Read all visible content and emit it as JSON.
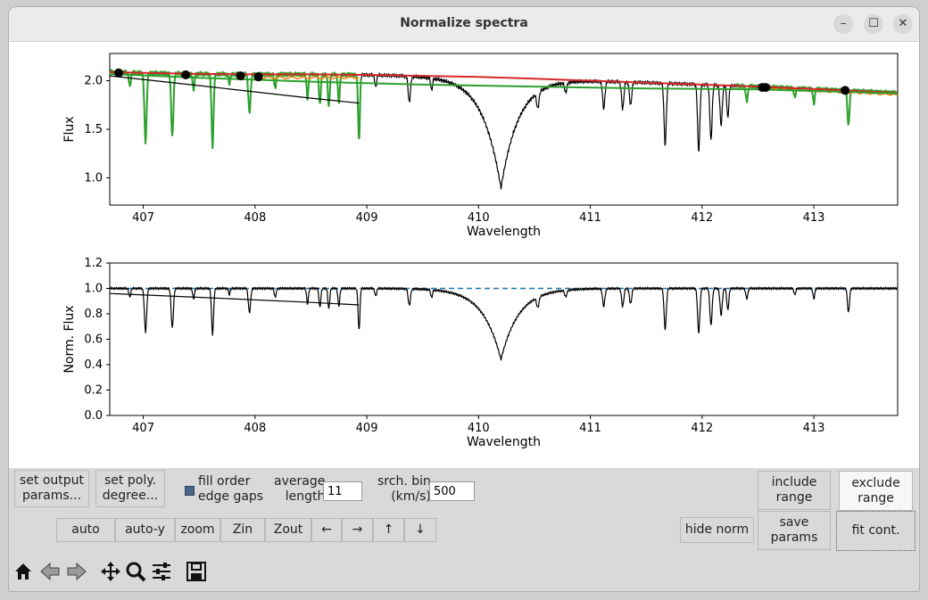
{
  "window": {
    "title": "Normalize spectra"
  },
  "colors": {
    "observed": "#000000",
    "fitted_spectrum": "#2ca02c",
    "continuum": "#d62728",
    "included_segment": "#ff7f0e",
    "reference_line": "#1f77b4"
  },
  "plots": {
    "top": {
      "ylabel": "Flux",
      "xlabel": "Wavelength",
      "xticks": [
        "407",
        "408",
        "409",
        "410",
        "411",
        "412",
        "413"
      ],
      "yticks": [
        "1.0",
        "1.5",
        "2.0"
      ]
    },
    "bottom": {
      "ylabel": "Norm. Flux",
      "xlabel": "Wavelength",
      "xticks": [
        "407",
        "408",
        "409",
        "410",
        "411",
        "412",
        "413"
      ],
      "yticks": [
        "0.0",
        "0.2",
        "0.4",
        "0.6",
        "0.8",
        "1.0",
        "1.2"
      ]
    }
  },
  "chart_data": [
    {
      "type": "line",
      "title": "",
      "xlabel": "Wavelength",
      "ylabel": "Flux",
      "xlim": [
        406.7,
        413.75
      ],
      "ylim": [
        0.72,
        2.28
      ],
      "grid": false,
      "continuum_points": {
        "x": [
          406.78,
          407.38,
          407.87,
          408.03,
          412.54,
          412.57,
          413.28
        ],
        "y": [
          2.08,
          2.06,
          2.05,
          2.04,
          1.93,
          1.93,
          1.9
        ]
      },
      "series": [
        {
          "x": [
            406.7,
            407.0,
            407.5,
            408.0,
            408.5,
            409.0,
            409.5,
            410.0,
            410.5,
            411.0,
            411.5,
            412.0,
            412.5,
            413.0,
            413.75
          ],
          "y": [
            2.09,
            2.08,
            2.07,
            2.065,
            2.065,
            2.06,
            2.05,
            2.04,
            2.02,
            2.0,
            1.98,
            1.96,
            1.94,
            1.915,
            1.875
          ]
        },
        {
          "x": [
            406.7,
            407.5,
            408.5,
            409.5,
            410.5,
            411.5,
            412.5,
            413.75
          ],
          "y": [
            2.07,
            2.03,
            1.99,
            1.96,
            1.94,
            1.92,
            1.91,
            1.87
          ]
        },
        {
          "x": [
            406.7,
            407.5,
            408.5,
            408.93
          ],
          "y": [
            2.05,
            1.95,
            1.82,
            1.77
          ]
        },
        {
          "x": [
            408.0,
            408.93
          ],
          "y": [
            2.04,
            2.02
          ]
        }
      ]
    },
    {
      "type": "line",
      "title": "",
      "xlabel": "Wavelength",
      "ylabel": "Norm. Flux",
      "xlim": [
        406.7,
        413.75
      ],
      "ylim": [
        0.0,
        1.2
      ],
      "grid": false,
      "series": [
        {
          "x": [
            406.7,
            413.75
          ],
          "y": [
            1.0,
            1.0
          ]
        },
        {
          "x": [
            406.7,
            407.5,
            408.5,
            408.93
          ],
          "y": [
            0.96,
            0.93,
            0.89,
            0.87
          ]
        }
      ]
    }
  ],
  "controls": {
    "set_output": "set output\nparams...",
    "set_poly": "set poly.\ndegree...",
    "fill_gaps": "fill order\nedge gaps",
    "average_length_label": "average\nlength",
    "average_length_value": "11",
    "srch_bin_label": "srch. bin\n(km/s)",
    "srch_bin_value": "500",
    "include_range": "include\nrange",
    "exclude_range": "exclude\nrange",
    "save_params": "save\nparams",
    "fit_cont": "fit cont.",
    "hide_norm": "hide norm",
    "auto": "auto",
    "auto_y": "auto-y",
    "zoom": "zoom",
    "zin": "Zin",
    "zout": "Zout",
    "left": "←",
    "right": "→",
    "up": "↑",
    "down": "↓"
  },
  "toolbar": {
    "icons": [
      "home-icon",
      "back-icon",
      "forward-icon",
      "pan-icon",
      "zoom-icon",
      "configure-icon",
      "save-icon"
    ]
  }
}
